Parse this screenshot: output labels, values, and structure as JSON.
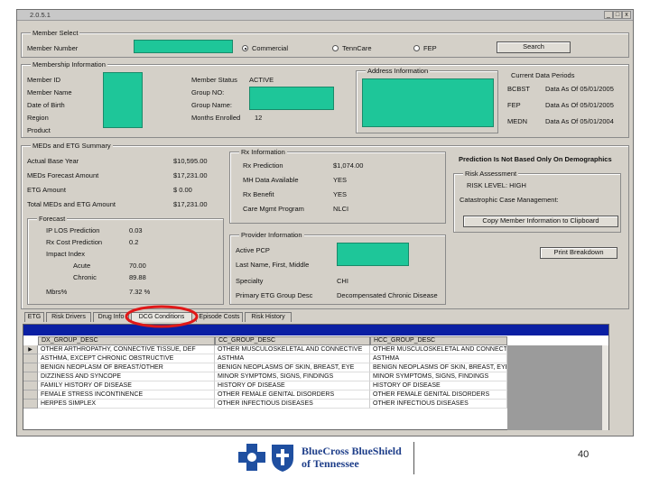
{
  "window": {
    "title": "2.0.5.1",
    "btn_min": "_",
    "btn_max": "□",
    "btn_close": "x"
  },
  "member_select": {
    "group_label": "Member Select",
    "member_number_label": "Member Number",
    "radio_commercial": "Commercial",
    "radio_tenncare": "TennCare",
    "radio_fep": "FEP",
    "search_button": "Search"
  },
  "membership": {
    "group_label": "Membership Information",
    "member_id_label": "Member ID",
    "member_name_label": "Member Name",
    "dob_label": "Date of Birth",
    "region_label": "Region",
    "product_label": "Product",
    "member_status_label": "Member Status",
    "member_status_value": "ACTIVE",
    "group_no_label": "Group NO:",
    "group_name_label": "Group Name:",
    "months_enrolled_label": "Months Enrolled",
    "months_enrolled_value": "12",
    "address_group_label": "Address Information",
    "current_periods_label": "Current Data Periods",
    "periods": [
      {
        "code": "BCBST",
        "value": "Data As Of 05/01/2005"
      },
      {
        "code": "FEP",
        "value": "Data As Of 05/01/2005"
      },
      {
        "code": "MEDN",
        "value": "Data As Of 05/01/2004"
      }
    ]
  },
  "med_summary": {
    "group_label": "MEDs and ETG Summary",
    "rows": [
      {
        "label": "Actual Base Year",
        "value": "$10,595.00"
      },
      {
        "label": "MEDs Forecast Amount",
        "value": "$17,231.00"
      },
      {
        "label": "ETG Amount",
        "value": "$ 0.00"
      },
      {
        "label": "Total MEDs and ETG Amount",
        "value": "$17,231.00"
      }
    ],
    "forecast_group_label": "Forecast",
    "forecast_rows": [
      {
        "label": "IP LOS Prediction",
        "value": "0.03"
      },
      {
        "label": "Rx Cost Prediction",
        "value": "0.2"
      },
      {
        "label": "Impact Index",
        "value": ""
      },
      {
        "label": "Acute",
        "value": "70.00"
      },
      {
        "label": "Chronic",
        "value": "89.88"
      },
      {
        "label": "Mbrs%",
        "value": "7.32 %"
      }
    ]
  },
  "rx_info": {
    "group_label": "Rx Information",
    "rows": [
      {
        "label": "Rx Prediction",
        "value": "$1,074.00"
      },
      {
        "label": "MH Data Available",
        "value": "YES"
      },
      {
        "label": "Rx Benefit",
        "value": "YES"
      },
      {
        "label": "Care Mgmt Program",
        "value": "NLCI"
      }
    ]
  },
  "prediction_note": "Prediction Is Not Based Only On Demographics",
  "risk_assessment": {
    "group_label": "Risk Assessment",
    "risk_level": "RISK LEVEL: HIGH",
    "catastrophic_label": "Catastrophic Case Management:",
    "copy_button": "Copy Member Information to Clipboard"
  },
  "provider_info": {
    "group_label": "Provider Information",
    "active_pcp_label": "Active PCP",
    "name_label": "Last Name, First, Middle",
    "specialty_label": "Specialty",
    "specialty_value": "CHI",
    "primary_etg_label": "Primary ETG Group Desc",
    "primary_etg_value": "Decompensated Chronic Disease"
  },
  "print_button": "Print Breakdown",
  "tabs": [
    {
      "label": "ETG"
    },
    {
      "label": "Risk Drivers"
    },
    {
      "label": "Drug Info"
    },
    {
      "label": "DCG Conditions"
    },
    {
      "label": "Episode Costs"
    },
    {
      "label": "Risk History"
    }
  ],
  "grid": {
    "columns": [
      "DX_GROUP_DESC",
      "CC_GROUP_DESC",
      "HCC_GROUP_DESC"
    ],
    "rows": [
      [
        "OTHER ARTHROPATHY, CONNECTIVE TISSUE, DEF",
        "OTHER MUSCULOSKELETAL AND CONNECTIVE",
        "OTHER MUSCULOSKELETAL AND CONNECTIVE"
      ],
      [
        "ASTHMA, EXCEPT CHRONIC OBSTRUCTIVE",
        "ASTHMA",
        "ASTHMA"
      ],
      [
        "BENIGN NEOPLASM OF BREAST/OTHER",
        "BENIGN NEOPLASMS OF SKIN, BREAST, EYE",
        "BENIGN NEOPLASMS OF SKIN, BREAST, EYE"
      ],
      [
        "DIZZINESS AND SYNCOPE",
        "MINOR SYMPTOMS, SIGNS, FINDINGS",
        "MINOR SYMPTOMS, SIGNS, FINDINGS"
      ],
      [
        "FAMILY HISTORY OF DISEASE",
        "HISTORY OF DISEASE",
        "HISTORY OF DISEASE"
      ],
      [
        "FEMALE STRESS INCONTINENCE",
        "OTHER FEMALE GENITAL DISORDERS",
        "OTHER FEMALE GENITAL DISORDERS"
      ],
      [
        "HERPES SIMPLEX",
        "OTHER INFECTIOUS DISEASES",
        "OTHER INFECTIOUS DISEASES"
      ]
    ]
  },
  "footer": {
    "logo_text_line1": "BlueCross BlueShield",
    "logo_text_line2": "of Tennessee",
    "page_number": "40"
  },
  "colors": {
    "teal": "#1ec699",
    "header_blue": "#0a1fa3",
    "highlight": "#e01818",
    "brand_blue": "#1f4fa0"
  }
}
